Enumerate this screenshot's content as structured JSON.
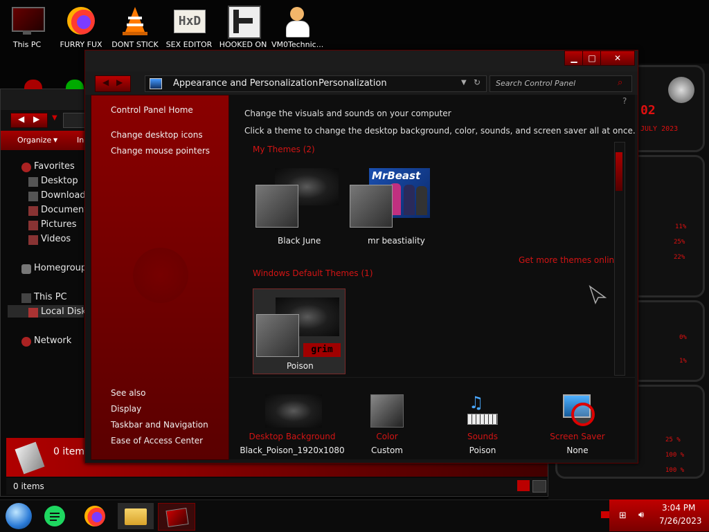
{
  "desktop_icons": [
    {
      "label": "This PC",
      "icon": "monitor-icon"
    },
    {
      "label": "FURRY FUX",
      "icon": "firefox-icon"
    },
    {
      "label": "DONT STICK",
      "icon": "vlc-cone-icon"
    },
    {
      "label": "SEX EDITOR",
      "icon": "hxd-editor-icon"
    },
    {
      "label": "HOOKED ON",
      "icon": "game-icon"
    },
    {
      "label": "VM0Technic...",
      "icon": "doctor-avatar-icon"
    }
  ],
  "explorer": {
    "toolbar": {
      "organize": "Organize",
      "include": "Inc"
    },
    "nav": {
      "favorites": "Favorites",
      "desktop": "Desktop",
      "downloads": "Downloads",
      "documents": "Documents",
      "pictures": "Pictures",
      "videos": "Videos",
      "homegroup": "Homegroup",
      "this_pc": "This PC",
      "local_disk": "Local Disk",
      "network": "Network"
    },
    "details_count": "0 items",
    "status_count": "0 items"
  },
  "control_panel": {
    "breadcrumb": [
      "Appearance and Personalization",
      "Personalization"
    ],
    "search_placeholder": "Search Control Panel",
    "left_links": [
      "Control Panel Home",
      "Change desktop icons",
      "Change mouse pointers"
    ],
    "see_also_heading": "See also",
    "see_also_links": [
      "Display",
      "Taskbar and Navigation",
      "Ease of Access Center"
    ],
    "heading": "Change the visuals and sounds on your computer",
    "subheading": "Click a theme to change the desktop background, color, sounds, and screen saver all at once.",
    "my_themes_heading": "My Themes (2)",
    "my_themes": [
      "Black June",
      "mr beastiality"
    ],
    "get_more_link": "Get more themes online",
    "default_themes_heading": "Windows Default Themes (1)",
    "default_themes": [
      "Poison"
    ],
    "thumbnail_text": {
      "mrbeast_logo": "MrBeast",
      "grim_badge": "grim"
    },
    "bottom_items": [
      {
        "title": "Desktop Background",
        "value": "Black_Poison_1920x1080",
        "icon": "wallpaper-thumbnail-icon"
      },
      {
        "title": "Color",
        "value": "Custom",
        "icon": "color-swatch-icon"
      },
      {
        "title": "Sounds",
        "value": "Poison",
        "icon": "music-notes-icon"
      },
      {
        "title": "Screen Saver",
        "value": "None",
        "icon": "screen-saver-icon"
      }
    ]
  },
  "widget": {
    "date": "JULY 2023",
    "counter": "02",
    "stats": [
      "11%",
      "25%",
      "22%",
      "0%",
      "1%",
      "25 %",
      "100 %",
      "100 %"
    ]
  },
  "taskbar": {
    "time": "3:04 PM",
    "date": "7/26/2023",
    "apps": [
      "start-orb-icon",
      "chat-app-icon",
      "firefox-icon",
      "file-explorer-icon",
      "personalization-app-icon"
    ]
  },
  "colors": {
    "accent": "#c00000",
    "accent_dark": "#6a0000",
    "link_red": "#d31414",
    "bg": "#0e0e0e"
  }
}
